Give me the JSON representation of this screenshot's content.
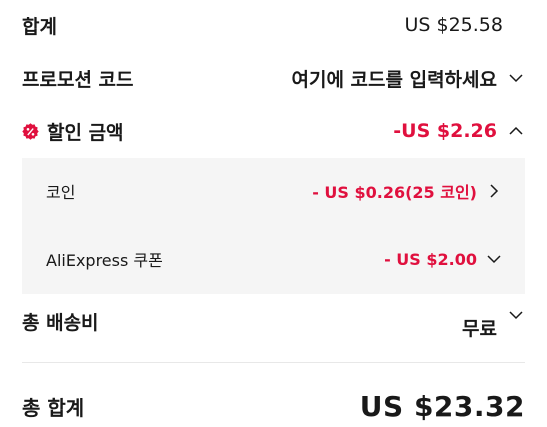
{
  "summary": {
    "subtotal_label": "합계",
    "subtotal_value": "US $25.58",
    "promo_label": "프로모션 코드",
    "promo_value": "여기에 코드를 입력하세요",
    "discount_label": "할인 금액",
    "discount_value": "-US $2.26",
    "coin_label": "코인",
    "coin_value": "- US $0.26(25 코인)",
    "coupon_label": "AliExpress 쿠폰",
    "coupon_value": "- US $2.00",
    "shipping_label": "총 배송비",
    "shipping_value": "무료",
    "total_label": "총 합계",
    "total_value": "US $23.32"
  },
  "colors": {
    "accent_red": "#e0103e",
    "panel_bg": "#f5f5f5",
    "text": "#191919"
  },
  "icons": {
    "discount_badge": "percent-badge-icon",
    "promo_toggle": "chevron-down-icon",
    "discount_toggle": "chevron-up-icon",
    "coin_toggle": "chevron-right-icon",
    "coupon_toggle": "chevron-down-icon",
    "shipping_toggle": "chevron-down-icon"
  }
}
